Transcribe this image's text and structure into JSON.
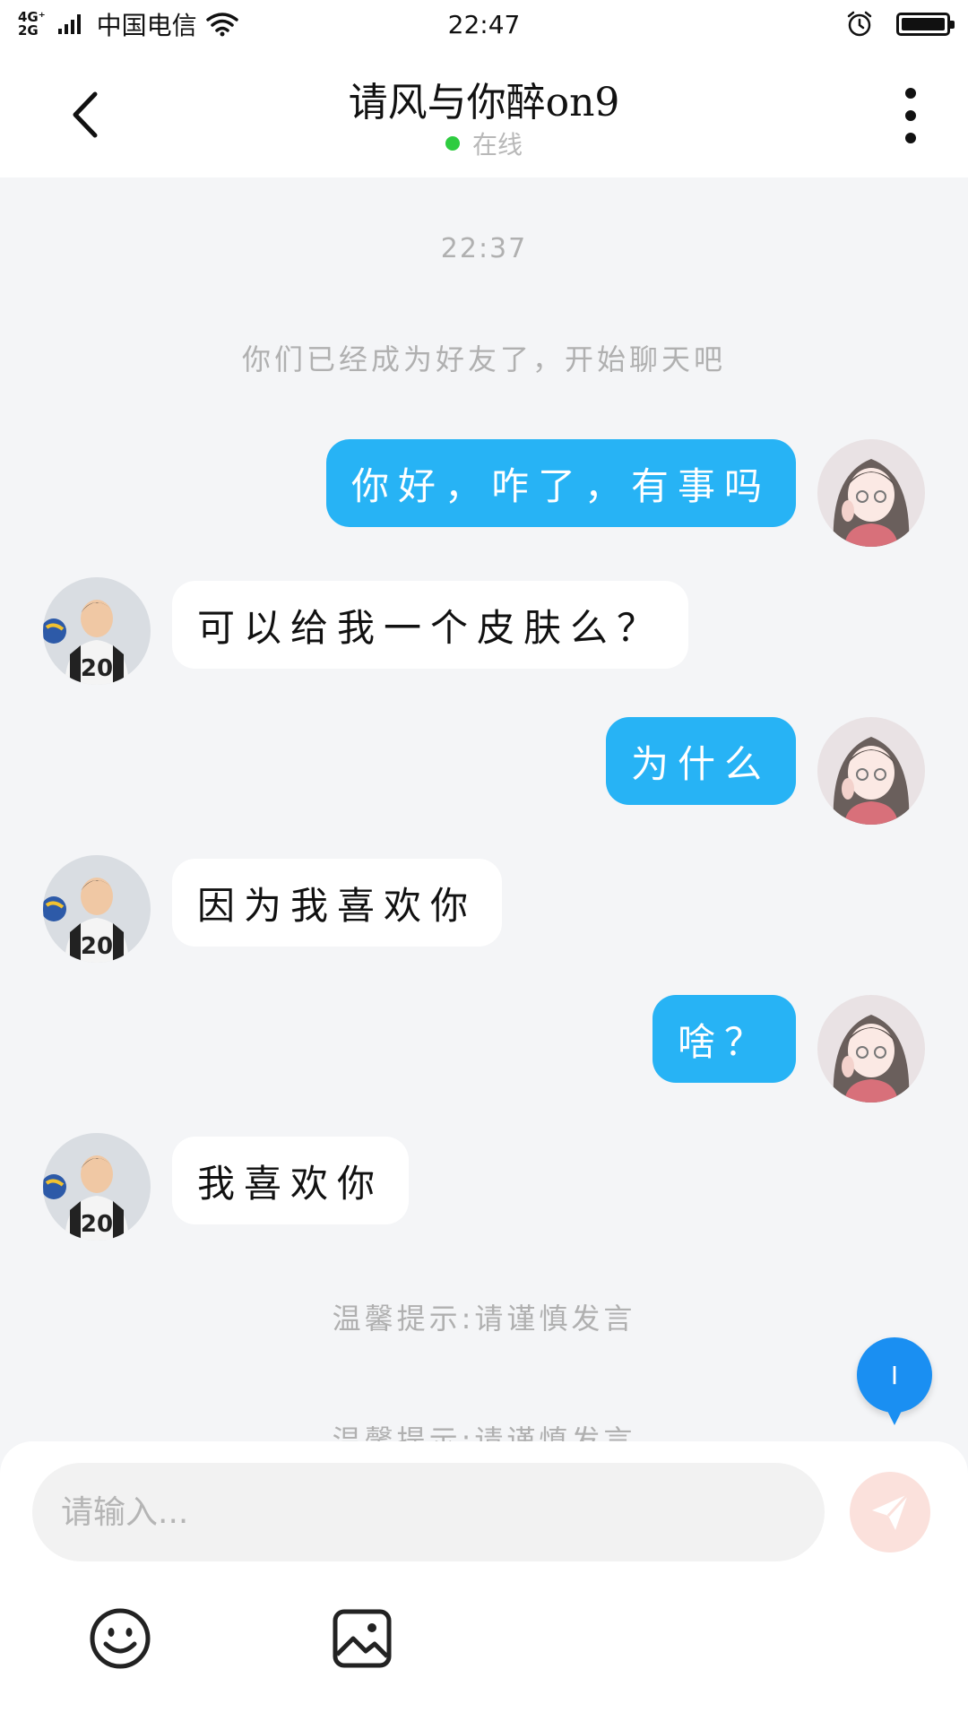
{
  "status_bar": {
    "network_top": "4G⁺",
    "network_bottom": "2G",
    "carrier": "中国电信",
    "time": "22:47",
    "icons": [
      "wifi-icon",
      "alarm-icon",
      "battery-icon"
    ]
  },
  "header": {
    "title": "请风与你醉on9",
    "status": "在线",
    "back_icon": "back-arrow-icon",
    "more_icon": "more-vertical-icon"
  },
  "chat": {
    "timestamp": "22:37",
    "system_message": "你们已经成为好友了，开始聊天吧",
    "messages": [
      {
        "from": "me",
        "text": "你好，咋了，有事吗"
      },
      {
        "from": "them",
        "text": "可以给我一个皮肤么？"
      },
      {
        "from": "me",
        "text": "为什么"
      },
      {
        "from": "them",
        "text": "因为我喜欢你"
      },
      {
        "from": "me",
        "text": "啥？"
      },
      {
        "from": "them",
        "text": "我喜欢你"
      }
    ],
    "tip": "温馨提示:请谨慎发言",
    "tip_partial": "温馨提示:请谨慎发言",
    "fab_label": "I"
  },
  "input": {
    "placeholder": "请输入...",
    "send_icon": "paper-plane-icon",
    "emoji_icon": "emoji-icon",
    "image_icon": "image-icon"
  },
  "colors": {
    "accent": "#27b3f5",
    "fab": "#1a8ff2",
    "online": "#2ecc40",
    "send_disabled": "#fbe1dc"
  }
}
